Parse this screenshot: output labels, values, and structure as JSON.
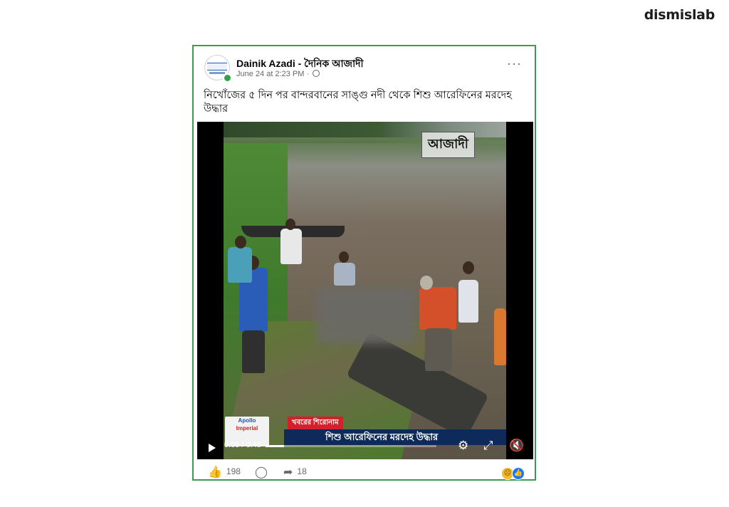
{
  "brand": {
    "logo_text": "dismislab"
  },
  "post": {
    "page_name": "Dainik Azadi - দৈনিক আজাদী",
    "timestamp": "June 24 at 2:23 PM",
    "separator": "·",
    "more_label": "···",
    "text": "নিখোঁজের ৫ দিন পর বান্দরবানের সাঙ্গু নদী থেকে শিশু আরেফিনের মরদেহ উদ্ধার"
  },
  "video": {
    "watermark": "আজাদী",
    "ticker_tag": "খবরের শিরোনাম",
    "ticker_text": "শিশু আরেফিনের মরদেহ উদ্ধার",
    "sponsor_line1": "Apollo",
    "sponsor_line2": "Imperial",
    "time_display": "0:05 / 0:45",
    "progress_fraction": 0.11
  },
  "footer": {
    "like_count": "198",
    "share_count": "18"
  },
  "colors": {
    "border": "#3c9a57",
    "ticker_red": "#d3202a",
    "ticker_blue": "#0d2a5a"
  },
  "icons": [
    "globe-icon",
    "more-icon",
    "play-icon",
    "settings-icon",
    "fullscreen-icon",
    "mute-icon",
    "like-icon",
    "comment-icon",
    "share-icon",
    "sad-reaction-icon",
    "like-reaction-icon"
  ]
}
